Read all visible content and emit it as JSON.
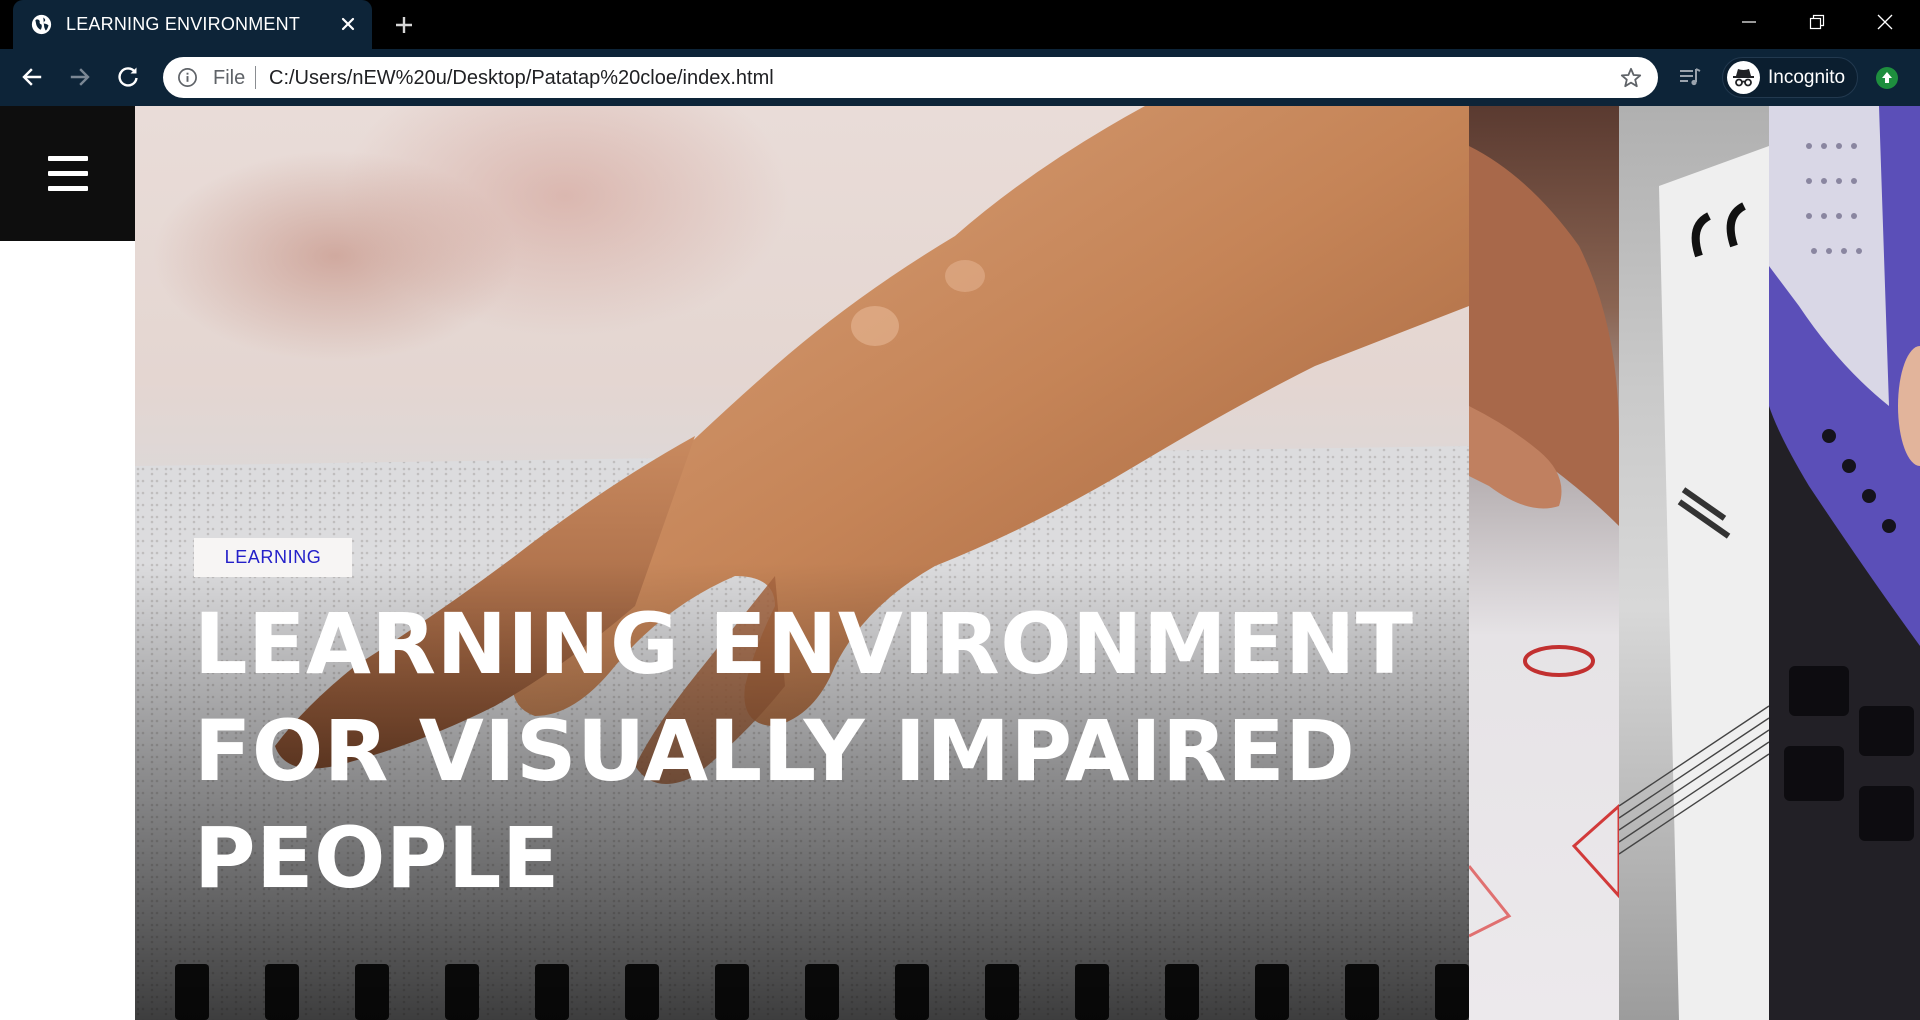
{
  "browser": {
    "tab_title": "LEARNING ENVIRONMENT",
    "omnibox": {
      "scheme_label": "File",
      "url": "C:/Users/nEW%20u/Desktop/Patatap%20cloe/index.html"
    },
    "profile_label": "Incognito",
    "icons": [
      "globe-icon",
      "close-icon",
      "plus-icon",
      "minimize-icon",
      "maximize-icon",
      "close-window-icon",
      "back-arrow-icon",
      "forward-arrow-icon",
      "reload-icon",
      "info-icon",
      "star-icon",
      "media-queue-icon",
      "incognito-icon",
      "update-arrow-icon"
    ]
  },
  "page": {
    "menu_icon": "hamburger-menu-icon",
    "hero": {
      "tag": "LEARNING",
      "headline_lines": [
        "LEARNING ENVIRONMENT",
        "FOR VISUALLY IMPAIRED",
        "PEOPLE"
      ]
    },
    "colors": {
      "tag_text": "#2420c9",
      "menu_bg": "#0e0e0e",
      "chrome_bg": "#0d2438"
    }
  }
}
